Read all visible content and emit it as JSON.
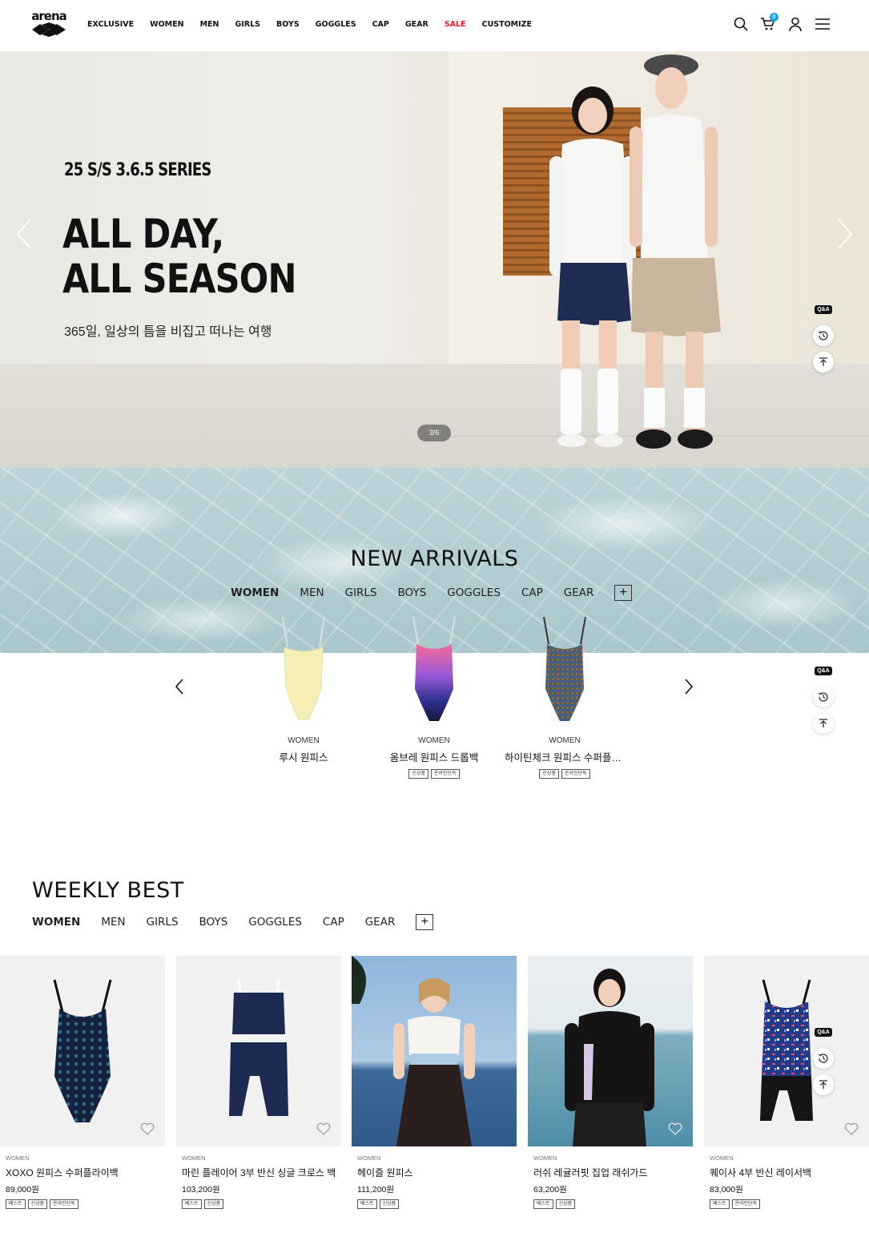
{
  "header": {
    "logo_text": "arena",
    "nav": [
      "EXCLUSIVE",
      "WOMEN",
      "MEN",
      "GIRLS",
      "BOYS",
      "GOGGLES",
      "CAP",
      "GEAR",
      "SALE",
      "CUSTOMIZE"
    ],
    "cart_count": "0",
    "icons": [
      "search-icon",
      "cart-icon",
      "user-icon",
      "menu-icon"
    ]
  },
  "hero": {
    "subtitle": "25 S/S 3.6.5 SERIES",
    "title_line1": "ALL DAY,",
    "title_line2": "ALL SEASON",
    "description": "365일, 일상의 틈을 비집고 떠나는 여행",
    "pager": "3/6"
  },
  "quick": {
    "qa_label": "Q&A"
  },
  "new_arrivals": {
    "title": "NEW ARRIVALS",
    "tabs": [
      "WOMEN",
      "MEN",
      "GIRLS",
      "BOYS",
      "GOGGLES",
      "CAP",
      "GEAR"
    ],
    "items": [
      {
        "category": "WOMEN",
        "name": "루시 원피스",
        "tags": []
      },
      {
        "category": "WOMEN",
        "name": "옴브레 원피스 드롭백",
        "tags": [
          "신상품",
          "온라인단독"
        ]
      },
      {
        "category": "WOMEN",
        "name": "하이틴체크 원피스 수퍼플라이백",
        "tags": [
          "신상품",
          "온라인단독"
        ]
      }
    ]
  },
  "weekly_best": {
    "title": "WEEKLY BEST",
    "tabs": [
      "WOMEN",
      "MEN",
      "GIRLS",
      "BOYS",
      "GOGGLES",
      "CAP",
      "GEAR"
    ],
    "items": [
      {
        "category": "WOMEN",
        "name": "XOXO 원피스 수퍼플라이백",
        "price": "89,000원",
        "tags": [
          "베스트",
          "신상품",
          "온라인단독"
        ]
      },
      {
        "category": "WOMEN",
        "name": "마린 플레이어 3부 반신 싱글 크로스 백",
        "price": "103,200원",
        "tags": [
          "베스트",
          "신상품"
        ]
      },
      {
        "category": "WOMEN",
        "name": "헤이즐 원피스",
        "price": "111,200원",
        "tags": [
          "베스트",
          "신상품"
        ]
      },
      {
        "category": "WOMEN",
        "name": "러쉬 레귤러핏 집업 래쉬가드",
        "price": "63,200원",
        "tags": [
          "베스트",
          "신상품"
        ]
      },
      {
        "category": "WOMEN",
        "name": "퀘이사 4부 반신 레이서백",
        "price": "83,000원",
        "tags": [
          "베스트",
          "온라인단독"
        ]
      }
    ]
  },
  "colors": {
    "sale": "#e8202a",
    "badge": "#1aa3e8"
  }
}
